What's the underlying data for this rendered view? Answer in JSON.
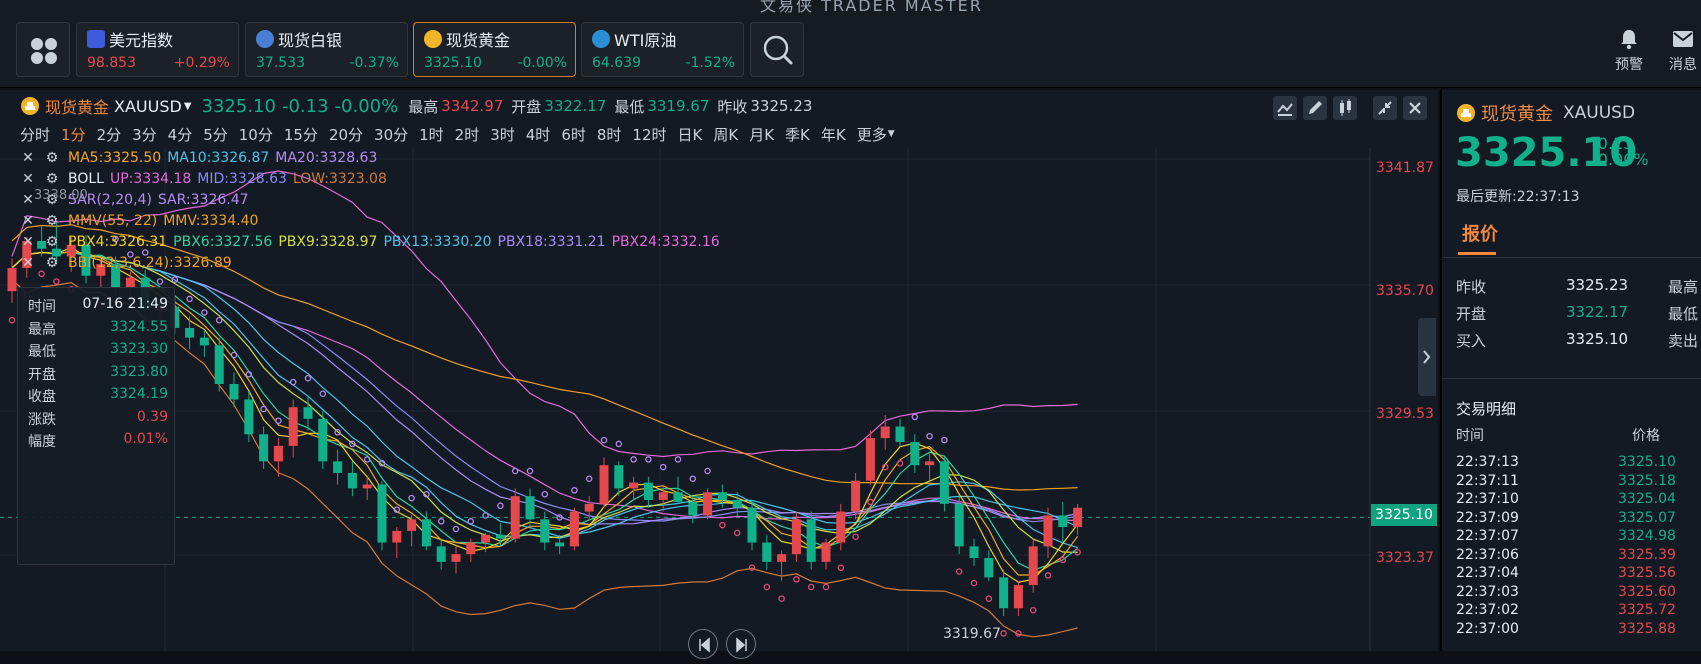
{
  "app_title": "文易侠 TRADER MASTER",
  "tickers": [
    {
      "name": "美元指数",
      "price": "98.853",
      "change": "+0.29%",
      "dir": "up",
      "icon": "us-flag-icon"
    },
    {
      "name": "现货白银",
      "price": "37.533",
      "change": "-0.37%",
      "dir": "down",
      "icon": "silver-icon"
    },
    {
      "name": "现货黄金",
      "price": "3325.10",
      "change": "-0.00%",
      "dir": "down",
      "icon": "gold-icon"
    },
    {
      "name": "WTI原油",
      "price": "64.639",
      "change": "-1.52%",
      "dir": "down",
      "icon": "oil-icon"
    }
  ],
  "top_right": {
    "alert": "预警",
    "message": "消息"
  },
  "chart_header": {
    "name": "现货黄金",
    "symbol": "XAUUSD",
    "price": "3325.10",
    "change": "-0.13",
    "change_pct": "-0.00%",
    "high_label": "最高",
    "high": "3342.97",
    "open_label": "开盘",
    "open": "3322.17",
    "low_label": "最低",
    "low": "3319.67",
    "prev_label": "昨收",
    "prev": "3325.23"
  },
  "periods": [
    "分时",
    "1分",
    "2分",
    "3分",
    "4分",
    "5分",
    "10分",
    "15分",
    "20分",
    "30分",
    "1时",
    "2时",
    "3时",
    "4时",
    "6时",
    "8时",
    "12时",
    "日K",
    "周K",
    "月K",
    "季K",
    "年K",
    "更多"
  ],
  "active_period": "1分",
  "indicators": [
    [
      {
        "t": "MA5:3325.50",
        "c": "#f5a623"
      },
      {
        "t": "MA10:3326.87",
        "c": "#4cc3e8"
      },
      {
        "t": "MA20:3328.63",
        "c": "#b58cf0"
      }
    ],
    [
      {
        "t": "BOLL",
        "c": "#e6edf3"
      },
      {
        "t": "UP:3334.18",
        "c": "#e36ad9"
      },
      {
        "t": "MID:3328.63",
        "c": "#8a8cf5"
      },
      {
        "t": "LOW:3323.08",
        "c": "#d07a3a"
      }
    ],
    [
      {
        "t": "SAR(2,20,4)",
        "c": "#b58cf0"
      },
      {
        "t": "SAR:3326.47",
        "c": "#b58cf0"
      }
    ],
    [
      {
        "t": "MMV(55, 22)",
        "c": "#f0a020"
      },
      {
        "t": "MMV:3334.40",
        "c": "#f0a020"
      }
    ],
    [
      {
        "t": "PBX4:3326.31",
        "c": "#f5d020"
      },
      {
        "t": "PBX6:3327.56",
        "c": "#2fd3a0"
      },
      {
        "t": "PBX9:3328.97",
        "c": "#d0e040"
      },
      {
        "t": "PBX13:3330.20",
        "c": "#4cc3e8"
      },
      {
        "t": "PBX18:3331.21",
        "c": "#a78cf5"
      },
      {
        "t": "PBX24:3332.16",
        "c": "#e36ad9"
      }
    ],
    [
      {
        "t": "BBI(12,3,6,24):3326.89",
        "c": "#f0a020"
      }
    ]
  ],
  "tooltip": [
    {
      "k": "时间",
      "v": "07-16 21:49",
      "c": "#e6edf3"
    },
    {
      "k": "最高",
      "v": "3324.55",
      "c": "#10b08a"
    },
    {
      "k": "最低",
      "v": "3323.30",
      "c": "#10b08a"
    },
    {
      "k": "开盘",
      "v": "3323.80",
      "c": "#10b08a"
    },
    {
      "k": "收盘",
      "v": "3324.19",
      "c": "#10b08a"
    },
    {
      "k": "涨跌",
      "v": "0.39",
      "c": "#e5484d"
    },
    {
      "k": "幅度",
      "v": "0.01%",
      "c": "#e5484d"
    }
  ],
  "price_axis": [
    "3341.87",
    "3335.70",
    "3329.53",
    "3323.37"
  ],
  "current_price": "3325.10",
  "low_marker": "3319.67",
  "partial_label": "3338.00",
  "side_panel": {
    "name": "现货黄金",
    "symbol": "XAUUSD",
    "price": "3325.10",
    "change": "-0.13",
    "change_pct": "-0.00%",
    "update": "最后更新:22:37:13",
    "tab": "报价",
    "quotes": [
      {
        "k": "昨收",
        "v": "3325.23",
        "c": "#e6edf3",
        "k2": "最高"
      },
      {
        "k": "开盘",
        "v": "3322.17",
        "c": "#10b08a",
        "k2": "最低"
      },
      {
        "k": "买入",
        "v": "3325.10",
        "c": "#e6edf3",
        "k2": "卖出"
      }
    ],
    "trades_title": "交易明细",
    "col_time": "时间",
    "col_price": "价格",
    "trades": [
      {
        "t": "22:37:13",
        "p": "3325.10",
        "c": "#10b08a"
      },
      {
        "t": "22:37:11",
        "p": "3325.18",
        "c": "#10b08a"
      },
      {
        "t": "22:37:10",
        "p": "3325.04",
        "c": "#10b08a"
      },
      {
        "t": "22:37:09",
        "p": "3325.07",
        "c": "#10b08a"
      },
      {
        "t": "22:37:07",
        "p": "3324.98",
        "c": "#10b08a"
      },
      {
        "t": "22:37:06",
        "p": "3325.39",
        "c": "#e5484d"
      },
      {
        "t": "22:37:04",
        "p": "3325.56",
        "c": "#e5484d"
      },
      {
        "t": "22:37:03",
        "p": "3325.60",
        "c": "#e5484d"
      },
      {
        "t": "22:37:02",
        "p": "3325.72",
        "c": "#e5484d"
      },
      {
        "t": "22:37:00",
        "p": "3325.88",
        "c": "#e5484d"
      }
    ]
  },
  "chart_data": {
    "type": "candlestick",
    "symbol": "XAUUSD",
    "ylim": [
      3318.5,
      3344.0
    ],
    "current": 3325.1,
    "candles": [
      [
        3336.8,
        3338.5,
        3336.2,
        3338.0
      ],
      [
        3338.0,
        3339.6,
        3337.5,
        3339.4
      ],
      [
        3339.4,
        3340.2,
        3338.6,
        3339.0
      ],
      [
        3339.0,
        3340.4,
        3338.2,
        3338.6
      ],
      [
        3338.6,
        3339.6,
        3337.8,
        3339.2
      ],
      [
        3339.2,
        3339.7,
        3337.2,
        3337.6
      ],
      [
        3337.6,
        3338.4,
        3337.0,
        3338.2
      ],
      [
        3338.2,
        3338.6,
        3336.6,
        3337.0
      ],
      [
        3337.0,
        3337.8,
        3336.4,
        3337.5
      ],
      [
        3337.5,
        3337.9,
        3335.4,
        3335.8
      ],
      [
        3335.8,
        3336.4,
        3334.8,
        3336.0
      ],
      [
        3336.0,
        3336.5,
        3334.6,
        3334.9
      ],
      [
        3334.9,
        3335.5,
        3333.8,
        3334.4
      ],
      [
        3334.4,
        3334.8,
        3333.4,
        3334.0
      ],
      [
        3334.0,
        3334.4,
        3331.6,
        3332.0
      ],
      [
        3332.0,
        3332.6,
        3330.8,
        3331.2
      ],
      [
        3331.2,
        3331.6,
        3329.0,
        3329.4
      ],
      [
        3329.4,
        3329.8,
        3327.6,
        3328.0
      ],
      [
        3328.0,
        3329.2,
        3327.2,
        3328.8
      ],
      [
        3328.8,
        3331.2,
        3328.2,
        3330.8
      ],
      [
        3330.8,
        3331.4,
        3329.6,
        3330.2
      ],
      [
        3330.2,
        3330.6,
        3327.6,
        3328.0
      ],
      [
        3328.0,
        3328.6,
        3326.8,
        3327.4
      ],
      [
        3327.4,
        3328.0,
        3326.2,
        3326.6
      ],
      [
        3326.6,
        3327.2,
        3326.0,
        3326.8
      ],
      [
        3326.8,
        3327.0,
        3323.4,
        3323.8
      ],
      [
        3323.8,
        3324.6,
        3323.0,
        3324.4
      ],
      [
        3324.4,
        3325.2,
        3323.6,
        3325.0
      ],
      [
        3325.0,
        3325.4,
        3323.4,
        3323.6
      ],
      [
        3323.6,
        3324.0,
        3322.4,
        3322.8
      ],
      [
        3322.8,
        3323.6,
        3322.2,
        3323.2
      ],
      [
        3323.2,
        3324.0,
        3322.8,
        3323.8
      ],
      [
        3323.8,
        3324.3,
        3323.3,
        3324.2
      ],
      [
        3324.2,
        3324.8,
        3323.6,
        3324.0
      ],
      [
        3324.0,
        3326.6,
        3323.8,
        3326.2
      ],
      [
        3326.2,
        3326.6,
        3324.6,
        3325.0
      ],
      [
        3325.0,
        3325.4,
        3323.4,
        3323.8
      ],
      [
        3323.8,
        3324.2,
        3323.2,
        3323.6
      ],
      [
        3323.6,
        3325.6,
        3323.4,
        3325.4
      ],
      [
        3325.4,
        3326.2,
        3325.0,
        3325.8
      ],
      [
        3325.8,
        3328.2,
        3325.6,
        3327.8
      ],
      [
        3327.8,
        3328.0,
        3326.2,
        3326.6
      ],
      [
        3326.6,
        3327.2,
        3326.0,
        3326.9
      ],
      [
        3326.9,
        3327.2,
        3325.6,
        3326.0
      ],
      [
        3326.0,
        3326.8,
        3325.4,
        3326.4
      ],
      [
        3326.4,
        3327.2,
        3325.8,
        3325.9
      ],
      [
        3325.9,
        3326.2,
        3324.8,
        3325.2
      ],
      [
        3325.2,
        3326.6,
        3325.0,
        3326.4
      ],
      [
        3326.4,
        3326.8,
        3325.6,
        3326.0
      ],
      [
        3326.0,
        3326.4,
        3325.2,
        3325.6
      ],
      [
        3325.6,
        3326.0,
        3323.4,
        3323.8
      ],
      [
        3323.8,
        3324.2,
        3322.4,
        3322.8
      ],
      [
        3322.8,
        3323.4,
        3321.8,
        3323.2
      ],
      [
        3323.2,
        3325.4,
        3322.8,
        3325.0
      ],
      [
        3325.0,
        3325.4,
        3322.4,
        3322.8
      ],
      [
        3322.8,
        3324.0,
        3322.4,
        3323.8
      ],
      [
        3323.8,
        3325.8,
        3323.4,
        3325.4
      ],
      [
        3325.4,
        3327.4,
        3325.0,
        3327.0
      ],
      [
        3327.0,
        3329.6,
        3326.8,
        3329.2
      ],
      [
        3329.2,
        3330.4,
        3328.6,
        3329.8
      ],
      [
        3329.8,
        3330.2,
        3328.8,
        3329.0
      ],
      [
        3329.0,
        3329.4,
        3327.4,
        3327.8
      ],
      [
        3327.8,
        3328.4,
        3327.0,
        3328.0
      ],
      [
        3328.0,
        3328.2,
        3325.4,
        3325.8
      ],
      [
        3325.8,
        3326.2,
        3323.2,
        3323.6
      ],
      [
        3323.6,
        3324.0,
        3322.6,
        3323.0
      ],
      [
        3323.0,
        3323.4,
        3321.8,
        3322.0
      ],
      [
        3322.0,
        3322.4,
        3320.0,
        3320.4
      ],
      [
        3320.4,
        3321.8,
        3320.0,
        3321.6
      ],
      [
        3321.6,
        3324.0,
        3321.2,
        3323.6
      ],
      [
        3323.6,
        3325.6,
        3323.0,
        3325.2
      ],
      [
        3325.2,
        3325.9,
        3323.8,
        3324.6
      ],
      [
        3324.6,
        3325.8,
        3324.2,
        3325.6
      ]
    ]
  }
}
